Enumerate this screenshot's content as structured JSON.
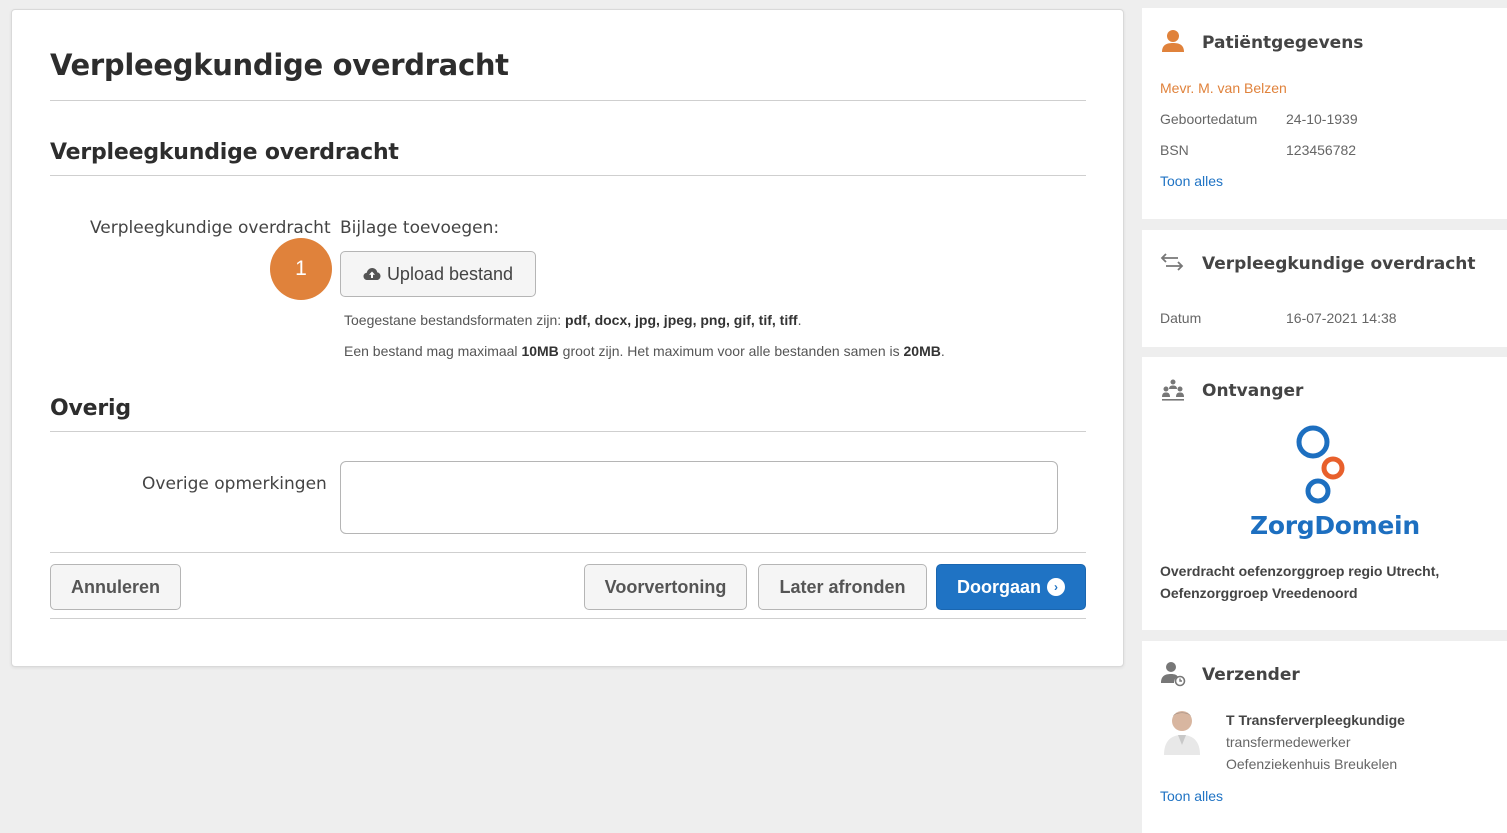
{
  "main": {
    "page_title": "Verpleegkundige overdracht",
    "section_title": "Verpleegkundige overdracht",
    "field_label": "Verpleegkundige overdracht",
    "attachment_label": "Bijlage toevoegen:",
    "upload_button": "Upload bestand",
    "step_badge": "1",
    "formats_prefix": "Toegestane bestandsformaten zijn: ",
    "formats_list": "pdf, docx, jpg, jpeg, png, gif, tif, tiff",
    "formats_suffix": ".",
    "size_prefix": "Een bestand mag maximaal ",
    "size_single": "10MB",
    "size_middle": " groot zijn. Het maximum voor alle bestanden samen is ",
    "size_total": "20MB",
    "size_suffix": ".",
    "other_section_title": "Overig",
    "other_label": "Overige opmerkingen",
    "other_value": ""
  },
  "actions": {
    "cancel": "Annuleren",
    "preview": "Voorvertoning",
    "later": "Later afronden",
    "continue": "Doorgaan"
  },
  "sidebar": {
    "patient": {
      "heading": "Patiëntgegevens",
      "name": "Mevr. M. van Belzen",
      "dob_label": "Geboortedatum",
      "dob_value": "24-10-1939",
      "bsn_label": "BSN",
      "bsn_value": "123456782",
      "show_all": "Toon alles"
    },
    "transfer": {
      "heading": "Verpleegkundige overdracht",
      "date_label": "Datum",
      "date_value": "16-07-2021 14:38"
    },
    "recipient": {
      "heading": "Ontvanger",
      "logo_text": "ZorgDomein",
      "org_line1": "Overdracht oefenzorggroep regio Utrecht,",
      "org_line2": "Oefenzorggroep Vreedenoord"
    },
    "sender": {
      "heading": "Verzender",
      "name": "T Transferverpleegkundige",
      "role": "transfermedewerker",
      "org": "Oefenziekenhuis Breukelen",
      "show_all": "Toon alles"
    }
  },
  "colors": {
    "accent": "#e0823b",
    "primary": "#1f73c4",
    "logo_blue": "#1d6fc0",
    "logo_orange": "#e8602c"
  },
  "icons": [
    "upload-cloud-icon",
    "person-icon",
    "transfer-arrows-icon",
    "people-icon",
    "person-clock-icon",
    "chevron-right-icon"
  ]
}
